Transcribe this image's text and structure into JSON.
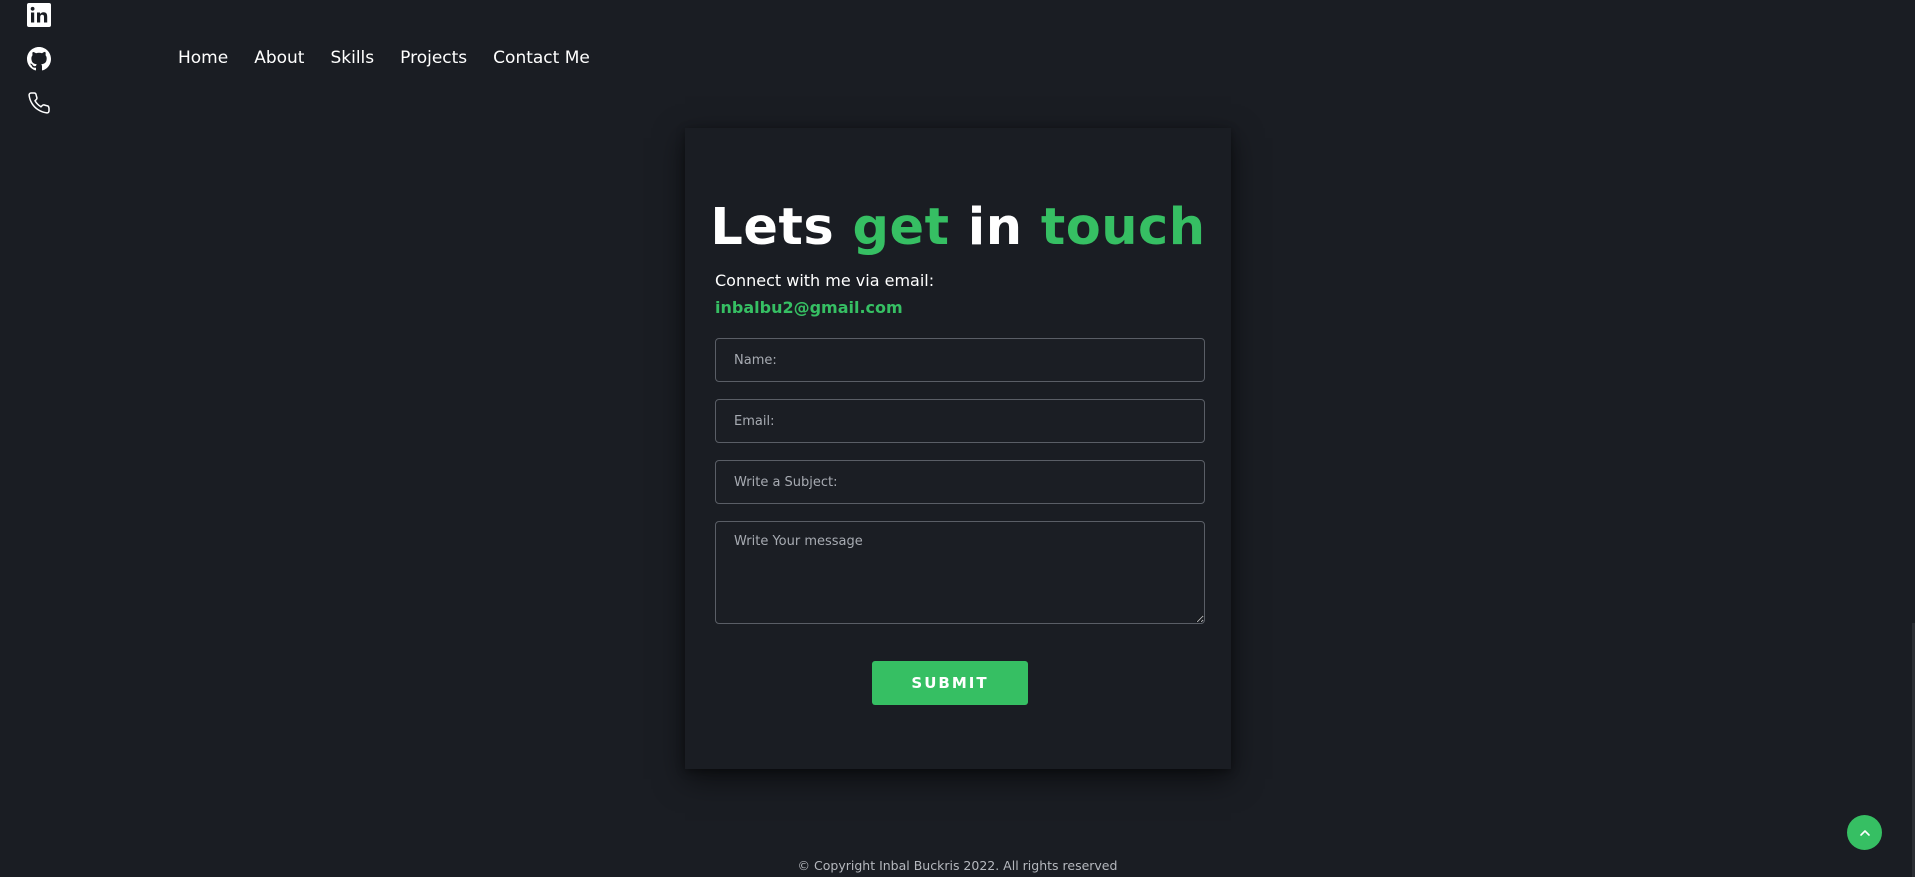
{
  "social": {
    "items": [
      {
        "icon": "linkedin-icon"
      },
      {
        "icon": "github-icon"
      },
      {
        "icon": "phone-icon"
      }
    ]
  },
  "nav": {
    "items": [
      "Home",
      "About",
      "Skills",
      "Projects",
      "Contact Me"
    ]
  },
  "contact": {
    "title_parts": [
      "Lets",
      "get",
      "in",
      "touch"
    ],
    "connect_text": "Connect with me via email:",
    "email": "inbalbu2@gmail.com",
    "placeholders": {
      "name": "Name:",
      "email": "Email:",
      "subject": "Write a Subject:",
      "message": "Write Your message"
    },
    "submit_label": "SUBMIT"
  },
  "footer": {
    "copyright": "© Copyright Inbal Buckris 2022. All rights reserved"
  },
  "colors": {
    "background": "#1a1d23",
    "accent": "#36bf63",
    "text": "#ffffff"
  }
}
